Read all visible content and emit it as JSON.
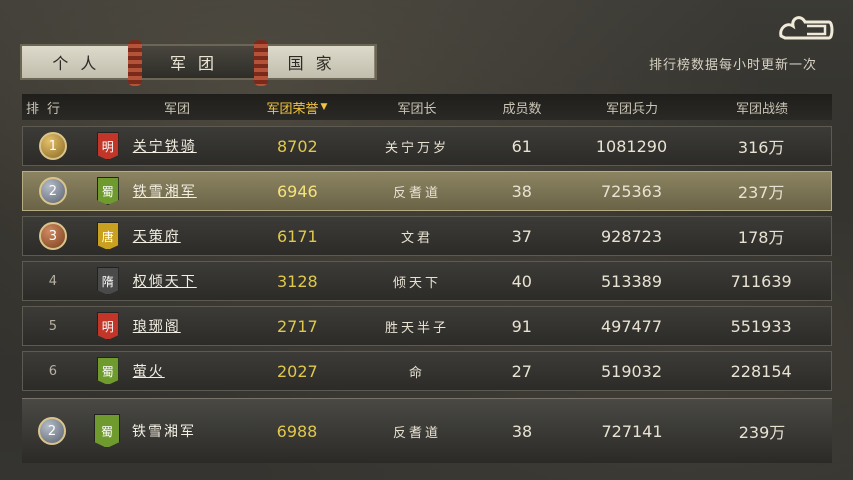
{
  "tabs": [
    {
      "label": "个人",
      "active": false
    },
    {
      "label": "军团",
      "active": true
    },
    {
      "label": "国家",
      "active": false
    }
  ],
  "update_note": "排行榜数据每小时更新一次",
  "logo_icon": "cloud-emblem-icon",
  "header": {
    "rank": "排行",
    "legion": "军团",
    "honor": "军团荣誉",
    "honor_sort_icon": "sort-desc-icon",
    "leader": "军团长",
    "members": "成员数",
    "power": "军团兵力",
    "record": "军团战绩"
  },
  "rows": [
    {
      "rank": "1",
      "emblem": "明",
      "emblem_color": "#c2362a",
      "name": "关宁铁骑",
      "honor": "8702",
      "leader": "关宁万岁",
      "members": "61",
      "power": "1081290",
      "record": "316万"
    },
    {
      "rank": "2",
      "emblem": "蜀",
      "emblem_color": "#6f9a2e",
      "name": "铁雪湘军",
      "honor": "6946",
      "leader": "反耆道",
      "members": "38",
      "power": "725363",
      "record": "237万"
    },
    {
      "rank": "3",
      "emblem": "唐",
      "emblem_color": "#c9a020",
      "name": "天策府",
      "honor": "6171",
      "leader": "文君",
      "members": "37",
      "power": "928723",
      "record": "178万"
    },
    {
      "rank": "4",
      "emblem": "隋",
      "emblem_color": "#4a4a4a",
      "name": "权倾天下",
      "honor": "3128",
      "leader": "倾天下",
      "members": "40",
      "power": "513389",
      "record": "711639"
    },
    {
      "rank": "5",
      "emblem": "明",
      "emblem_color": "#c2362a",
      "name": "琅琊阁",
      "honor": "2717",
      "leader": "胜天半子",
      "members": "91",
      "power": "497477",
      "record": "551933"
    },
    {
      "rank": "6",
      "emblem": "蜀",
      "emblem_color": "#6f9a2e",
      "name": "萤火",
      "honor": "2027",
      "leader": "命",
      "members": "27",
      "power": "519032",
      "record": "228154"
    }
  ],
  "own": {
    "rank": "2",
    "emblem": "蜀",
    "emblem_color": "#6f9a2e",
    "name": "铁雪湘军",
    "honor": "6988",
    "leader": "反耆道",
    "members": "38",
    "power": "727141",
    "record": "239万"
  }
}
